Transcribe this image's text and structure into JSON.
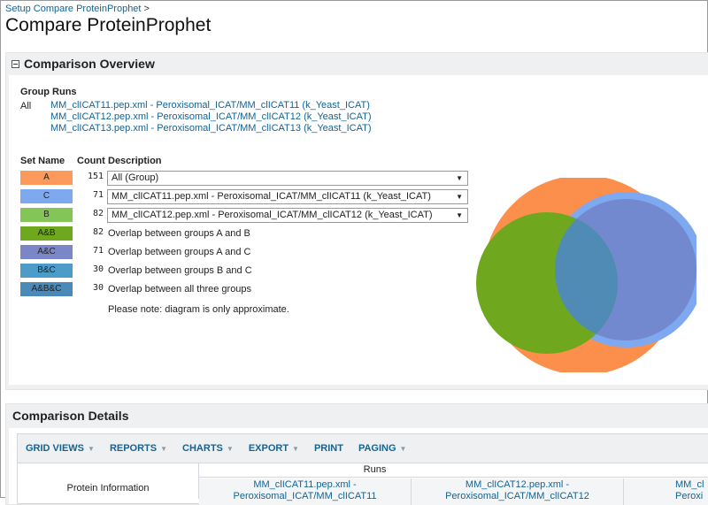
{
  "breadcrumb": {
    "link": "Setup Compare ProteinProphet",
    "separator": ">"
  },
  "page_title": "Compare ProteinProphet",
  "overview": {
    "title": "Comparison Overview",
    "group_runs_label": "Group Runs",
    "all_label": "All",
    "runs": [
      "MM_clICAT11.pep.xml - Peroxisomal_ICAT/MM_clICAT11 (k_Yeast_ICAT)",
      "MM_clICAT12.pep.xml - Peroxisomal_ICAT/MM_clICAT12 (k_Yeast_ICAT)",
      "MM_clICAT13.pep.xml - Peroxisomal_ICAT/MM_clICAT13 (k_Yeast_ICAT)"
    ],
    "headers": {
      "set_name": "Set Name",
      "count": "Count",
      "description": "Description"
    },
    "sets": [
      {
        "name": "A",
        "count": "151",
        "description": "All (Group)",
        "is_select": true,
        "color": "#fb9a5a"
      },
      {
        "name": "C",
        "count": "71",
        "description": "MM_clICAT11.pep.xml - Peroxisomal_ICAT/MM_clICAT11 (k_Yeast_ICAT)",
        "is_select": true,
        "color": "#7ea8f0"
      },
      {
        "name": "B",
        "count": "82",
        "description": "MM_clICAT12.pep.xml - Peroxisomal_ICAT/MM_clICAT12 (k_Yeast_ICAT)",
        "is_select": true,
        "color": "#84c558"
      },
      {
        "name": "A&B",
        "count": "82",
        "description": "Overlap between groups A and B",
        "is_select": false,
        "color": "#6fa81e"
      },
      {
        "name": "A&C",
        "count": "71",
        "description": "Overlap between groups A and C",
        "is_select": false,
        "color": "#7a86c8"
      },
      {
        "name": "B&C",
        "count": "30",
        "description": "Overlap between groups B and C",
        "is_select": false,
        "color": "#4d9bc9"
      },
      {
        "name": "A&B&C",
        "count": "30",
        "description": "Overlap between all three groups",
        "is_select": false,
        "color": "#4a8ab8"
      }
    ],
    "note": "Please note: diagram is only approximate.",
    "venn_colors": {
      "a": "#fd8f4c",
      "b": "#6fa81e",
      "c": "#7288cf",
      "c_edge": "#7ea8f0",
      "abc": "#4f8bb5"
    }
  },
  "details": {
    "title": "Comparison Details",
    "toolbar": [
      {
        "label": "GRID VIEWS",
        "caret": true
      },
      {
        "label": "REPORTS",
        "caret": true
      },
      {
        "label": "CHARTS",
        "caret": true
      },
      {
        "label": "EXPORT",
        "caret": true
      },
      {
        "label": "PRINT",
        "caret": false
      },
      {
        "label": "PAGING",
        "caret": true
      }
    ],
    "protein_info_label": "Protein Information",
    "runs_label": "Runs",
    "run_columns": [
      {
        "line1": "MM_clICAT11.pep.xml -",
        "line2": "Peroxisomal_ICAT/MM_clICAT11"
      },
      {
        "line1": "MM_clICAT12.pep.xml -",
        "line2": "Peroxisomal_ICAT/MM_clICAT12"
      },
      {
        "line1": "MM_cl",
        "line2": "Peroxi"
      }
    ]
  }
}
